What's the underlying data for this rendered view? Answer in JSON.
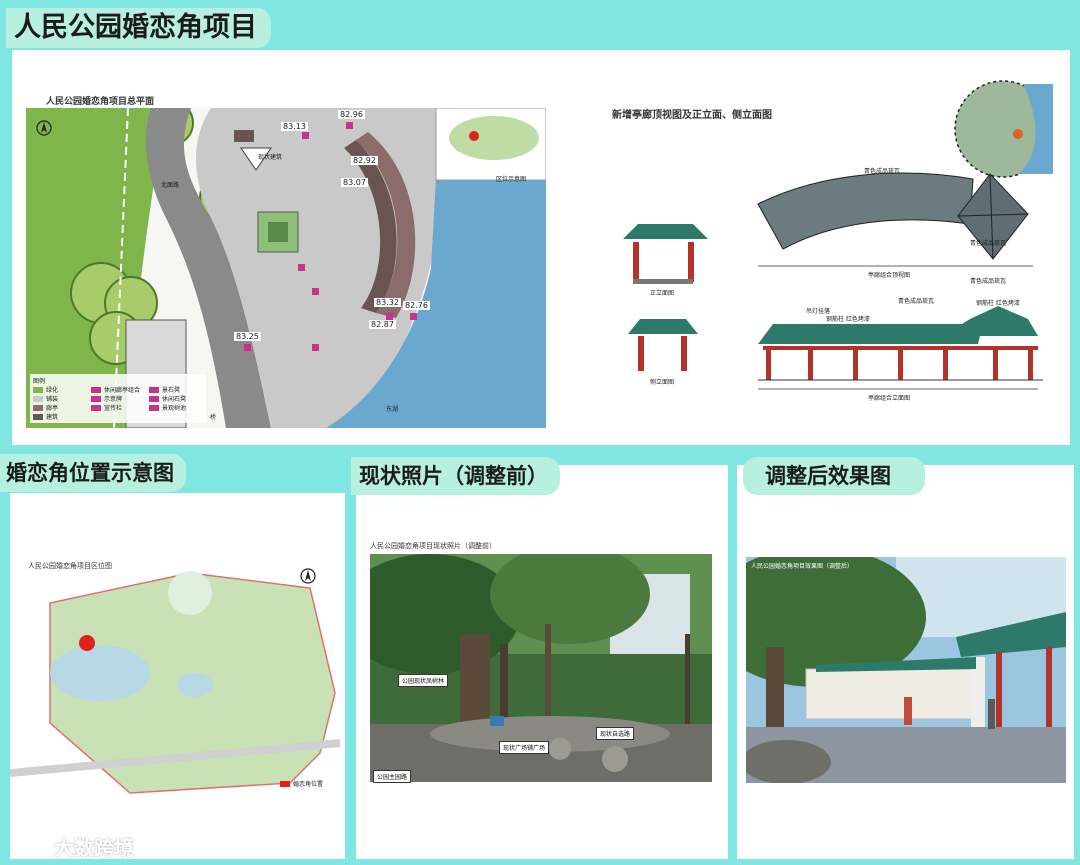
{
  "title": "人民公园婚恋角项目",
  "top_panel": {
    "plan_title": "人民公园婚恋角项目总平面",
    "elevations": [
      "83.13",
      "82.96",
      "82.92",
      "83.07",
      "83.32",
      "82.76",
      "82.87",
      "83.25"
    ],
    "labels": {
      "existing_building": "现状建筑",
      "location_diagram": "区位示意图",
      "north_road": "北面路",
      "east_lake": "东湖",
      "bridge": "桥",
      "building": "建筑"
    },
    "legend": {
      "title": "图例",
      "items": [
        "绿化",
        "铺装",
        "廊亭",
        "建筑",
        "休闲廊亭组合",
        "示意牌",
        "宣传栏",
        "景石凳",
        "休闲石凳",
        "景观树池"
      ]
    },
    "elevation_title": "新增亭廊顶视图及正立面、侧立面图",
    "elevation_labels": {
      "roof_tile_1": "青色成品琉瓦",
      "roof_tile_2": "青色成品琉瓦",
      "roof_tile_3": "青色成品琉瓦",
      "plan_view": "亭廊组合顶视图",
      "front_view": "正立面图",
      "side_view": "侧立面图",
      "front_elev": "亭廊组合立面图",
      "lamp": "吊灯挂落",
      "pillar_1": "钢筋柱 红色烤漆",
      "pillar_2": "钢筋柱 红色烤漆",
      "roof_3": "青色成品琉瓦"
    }
  },
  "panel_location": {
    "heading": "婚恋角位置示意图",
    "subtitle": "人民公园婚恋角项目区位图",
    "legend_text": "婚恋角位置"
  },
  "panel_photo": {
    "heading": "现状照片（调整前）",
    "subtitle": "人民公园婚恋角项目现状照片（调整前）",
    "labels": [
      "公园现状凤树林",
      "现状广场铺广场",
      "现状自选路",
      "公园主园路"
    ]
  },
  "panel_render": {
    "heading": "调整后效果图",
    "subtitle": "人民公园婚恋角项目效果图（调整后）"
  },
  "watermark": "大数跨境",
  "colors": {
    "background": "#7fe6e2",
    "heading_bg": "#b8f0df",
    "marker": "#c8328c",
    "location_dot": "#e0221f",
    "roof": "#2d7a6a",
    "pillar": "#b3322a"
  }
}
